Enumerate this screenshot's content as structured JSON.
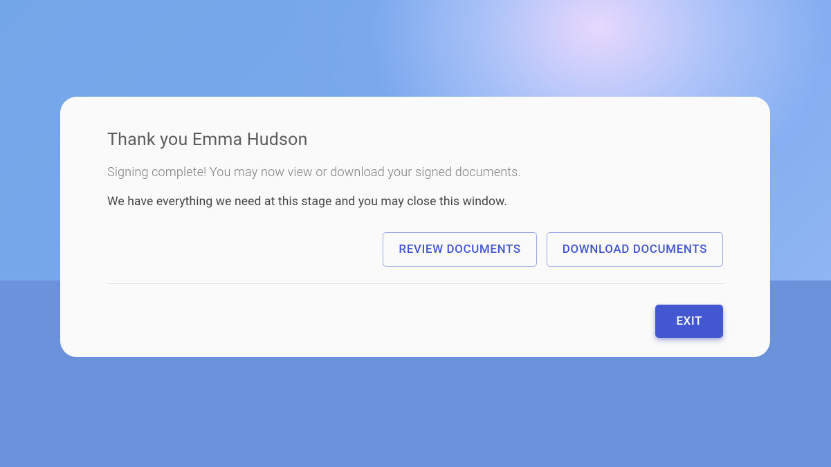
{
  "card": {
    "title": "Thank you Emma Hudson",
    "subtitle": "Signing complete! You may now view or download your signed documents.",
    "instruction": "We have everything we need at this stage and you may close this window.",
    "actions": {
      "review": "REVIEW DOCUMENTS",
      "download": "DOWNLOAD DOCUMENTS"
    },
    "footer": {
      "exit": "EXIT"
    }
  }
}
